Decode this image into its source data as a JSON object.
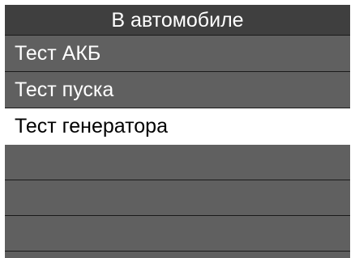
{
  "header": {
    "title": "В автомобиле"
  },
  "menu": {
    "items": [
      {
        "label": "Тест АКБ",
        "selected": false
      },
      {
        "label": "Тест пуска",
        "selected": false
      },
      {
        "label": "Тест генератора",
        "selected": true
      },
      {
        "label": "",
        "selected": false
      },
      {
        "label": "",
        "selected": false
      },
      {
        "label": "",
        "selected": false
      }
    ]
  },
  "colors": {
    "header_bg": "#3f3f3f",
    "item_bg": "#606060",
    "selected_bg": "#ffffff",
    "text_light": "#ffffff",
    "text_dark": "#000000"
  }
}
